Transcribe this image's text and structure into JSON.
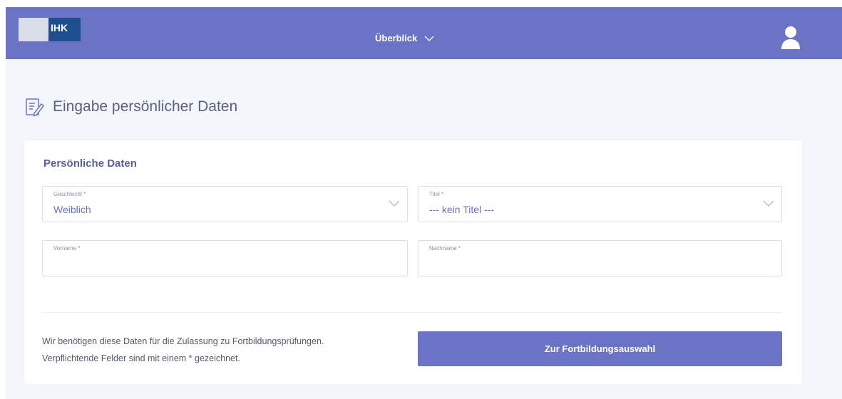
{
  "header": {
    "logo_text": "IHK",
    "nav_label": "Überblick",
    "colors": {
      "header_bg": "#6b74c4",
      "logo_blue": "#1f4e8f"
    }
  },
  "page": {
    "title": "Eingabe persönlicher Daten",
    "title_icon": "edit-document-icon"
  },
  "form": {
    "section_title": "Persönliche Daten",
    "gender": {
      "label": "Geschlecht *",
      "value": "Weiblich"
    },
    "title": {
      "label": "Titel *",
      "value": "--- kein Titel ---"
    },
    "first_name": {
      "label": "Vorname *",
      "value": ""
    },
    "last_name": {
      "label": "Nachname *",
      "value": ""
    }
  },
  "footer": {
    "info_line1": "Wir benötigen diese Daten für die Zulassung zu Fortbildungsprüfungen.",
    "info_line2": "Verpflichtende Felder sind mit einem * gezeichnet.",
    "cta_label": "Zur Fortbildungsauswahl"
  }
}
